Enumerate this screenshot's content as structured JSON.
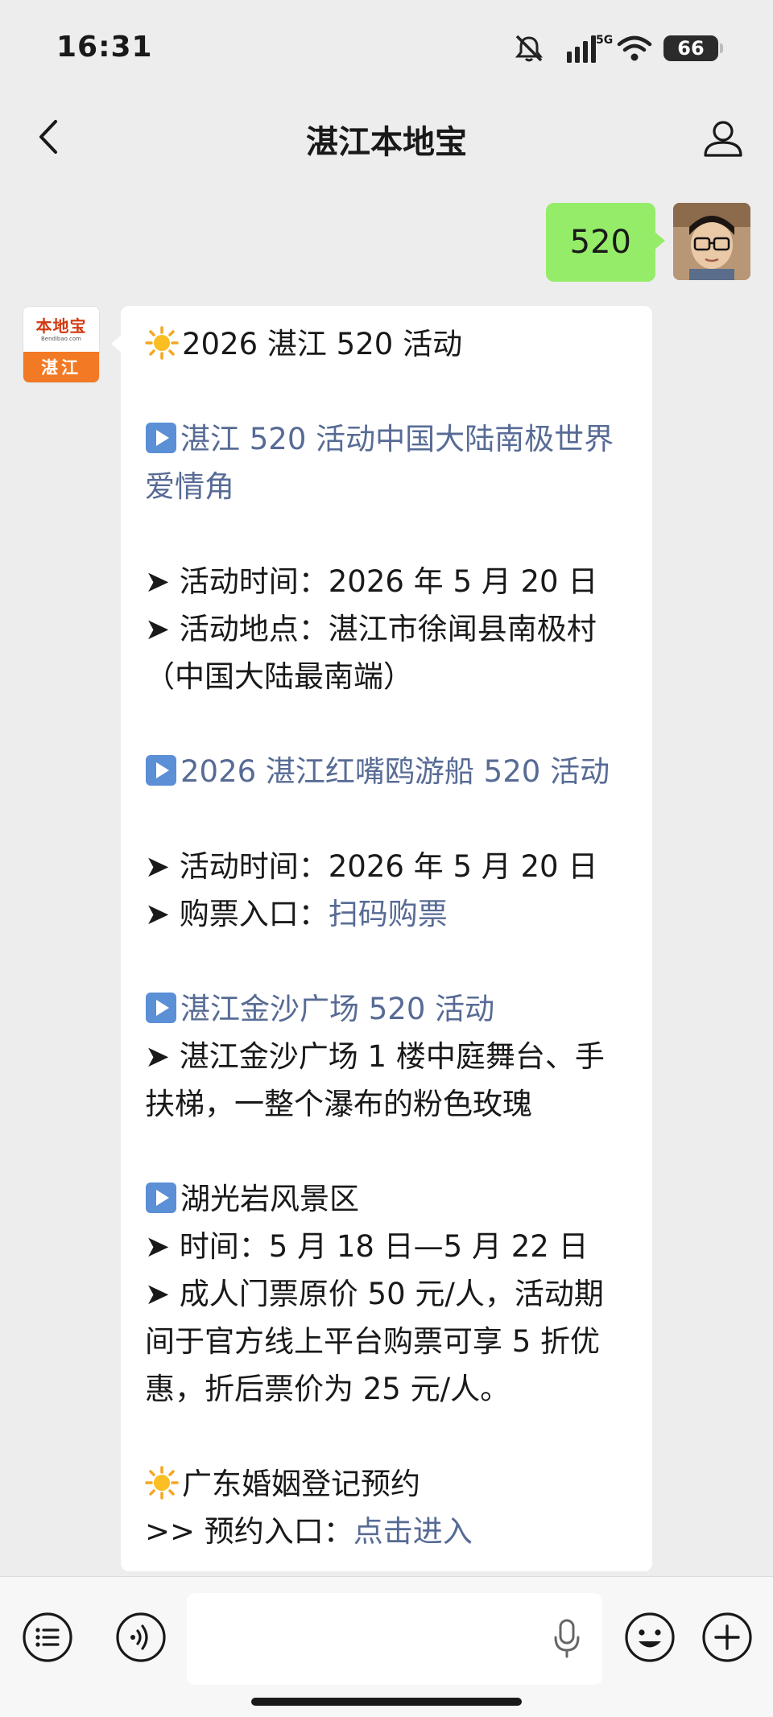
{
  "status_bar": {
    "time": "16:31",
    "network": "5G",
    "battery": "66",
    "icons": [
      "mute-icon",
      "signal-icon",
      "wifi-icon",
      "battery-icon"
    ]
  },
  "nav": {
    "title": "湛江本地宝",
    "back_icon": "chevron-left-icon",
    "profile_icon": "person-icon"
  },
  "user_message": {
    "text": "520"
  },
  "bot": {
    "logo_cn": "本地宝",
    "logo_en": "Bendibao.com",
    "logo_city": "湛江",
    "messages": {
      "title": "2026 湛江 520 活动",
      "s1_heading": "湛江 520 活动中国大陆南极世界爱情角",
      "s1_time": "➤ 活动时间：2026 年 5 月 20 日",
      "s1_place": "➤ 活动地点：湛江市徐闻县南极村（中国大陆最南端）",
      "s2_heading": "2026 湛江红嘴鸥游船 520 活动",
      "s2_time": "➤ 活动时间：2026 年 5 月 20 日",
      "s2_ticket_label": "➤ 购票入口：",
      "s2_ticket_link": "扫码购票",
      "s3_heading": "湛江金沙广场 520 活动",
      "s3_text": "➤ 湛江金沙广场 1 楼中庭舞台、手扶梯，一整个瀑布的粉色玫瑰",
      "s4_heading": "湖光岩风景区",
      "s4_time": "➤ 时间：5 月 18 日—5 月 22 日",
      "s4_price": "➤ 成人门票原价 50 元/人，活动期间于官方线上平台购票可享 5 折优惠，折后票价为 25 元/人。",
      "s5_heading": "广东婚姻登记预约",
      "s5_label": ">> 预约入口：",
      "s5_link": "点击进入"
    }
  },
  "input_bar": {
    "placeholder": "",
    "left_icons": [
      "list-icon",
      "voice-icon"
    ],
    "right_icons": [
      "microphone-icon",
      "emoji-icon",
      "plus-icon"
    ]
  },
  "colors": {
    "background": "#ededed",
    "user_bubble": "#95ec69",
    "link": "#576b95",
    "logo_orange": "#f27a25"
  }
}
